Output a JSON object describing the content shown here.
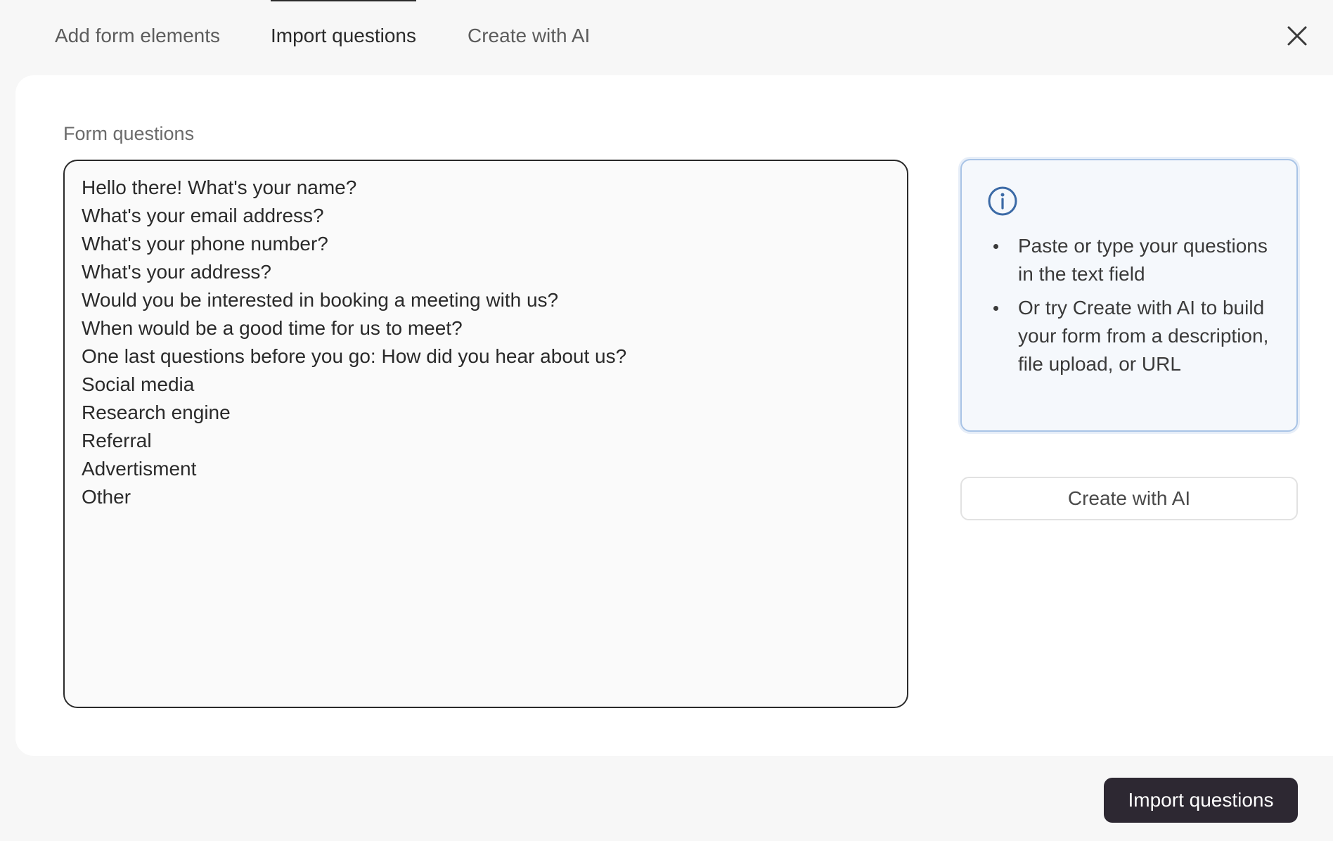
{
  "tabs": [
    {
      "label": "Add form elements",
      "active": false
    },
    {
      "label": "Import questions",
      "active": true
    },
    {
      "label": "Create with AI",
      "active": false
    }
  ],
  "close_icon": "close-icon",
  "form": {
    "label": "Form questions",
    "questions_text": "Hello there! What's your name?\nWhat's your email address?\nWhat's your phone number?\nWhat's your address?\nWould you be interested in booking a meeting with us?\nWhen would be a good time for us to meet?\nOne last questions before you go: How did you hear about us?\nSocial media\nResearch engine\nReferral\nAdvertisment\nOther"
  },
  "info": {
    "icon": "info-icon",
    "items": [
      "Paste or type your questions in the text field",
      "Or try Create with AI to build your form from a description, file upload, or URL"
    ]
  },
  "create_ai_button": {
    "label": "Create with AI"
  },
  "import_button": {
    "label": "Import questions"
  },
  "colors": {
    "background": "#f7f7f7",
    "card": "#ffffff",
    "primary_button": "#2d2832",
    "info_border": "#a9c4e6",
    "info_icon": "#3b6aa6"
  }
}
